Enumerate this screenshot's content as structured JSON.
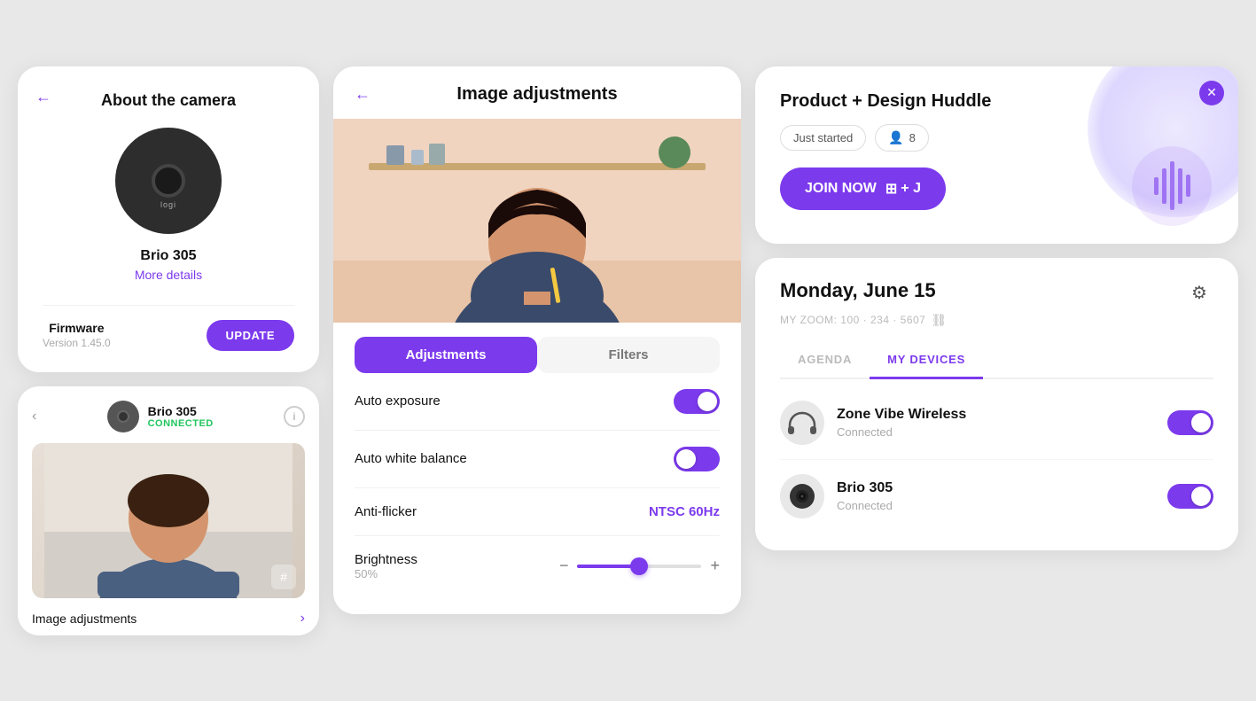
{
  "col1": {
    "about_camera": {
      "title": "About the camera",
      "back_label": "←",
      "device_name": "Brio 305",
      "more_details": "More details",
      "logi_label": "logi",
      "firmware": {
        "label": "Firmware",
        "version": "Version 1.45.0",
        "update_btn": "UPDATE"
      }
    },
    "brio_preview": {
      "device_name": "Brio 305",
      "connected": "CONNECTED",
      "image_adj_label": "Image adjustments",
      "hash_tag": "#",
      "nav_left": "‹",
      "info": "i"
    }
  },
  "col2": {
    "header": {
      "back_label": "←",
      "title": "Image adjustments"
    },
    "tabs": {
      "adjustments": "Adjustments",
      "filters": "Filters"
    },
    "settings": [
      {
        "label": "Auto exposure",
        "type": "toggle",
        "value": true
      },
      {
        "label": "Auto white balance",
        "type": "toggle",
        "value": true
      },
      {
        "label": "Anti-flicker",
        "type": "value",
        "value": "NTSC 60Hz"
      },
      {
        "label": "Brightness",
        "type": "slider",
        "value": 50,
        "percent": "50%"
      }
    ]
  },
  "col3": {
    "huddle": {
      "title": "Product + Design Huddle",
      "status": "Just started",
      "attendees": "8",
      "attendees_icon": "👤",
      "join_btn": "JOIN NOW",
      "shortcut": "⊞ + J",
      "close": "✕"
    },
    "calendar": {
      "date": "Monday, June 15",
      "zoom_label": "MY ZOOM: 100 · 234 · 5607",
      "tabs": {
        "agenda": "AGENDA",
        "my_devices": "MY DEVICES"
      },
      "devices": [
        {
          "name": "Zone Vibe Wireless",
          "status": "Connected",
          "icon_type": "headphone",
          "enabled": true
        },
        {
          "name": "Brio 305",
          "status": "Connected",
          "icon_type": "camera",
          "enabled": true
        }
      ]
    }
  }
}
